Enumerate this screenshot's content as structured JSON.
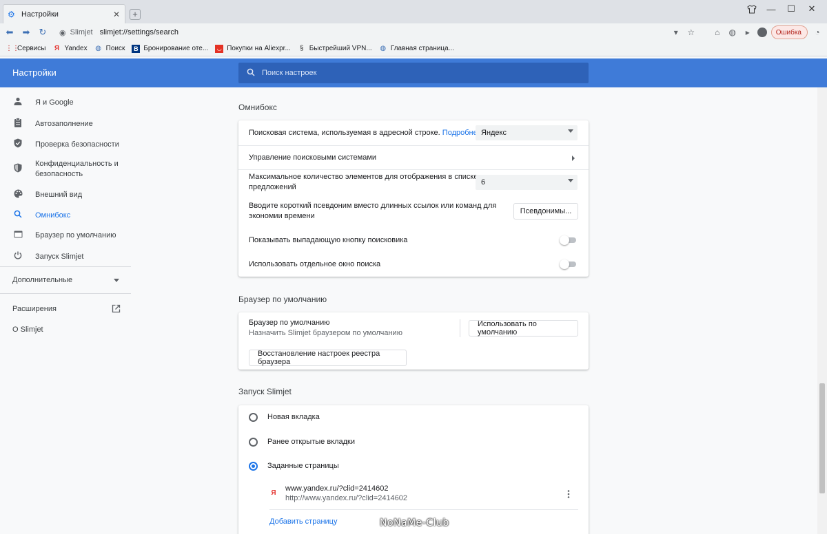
{
  "browser": {
    "tab_title": "Настройки",
    "site_label": "Slimjet",
    "url": "slimjet://settings/search",
    "error_label": "Ошибка"
  },
  "bookmarks": [
    {
      "label": "Сервисы",
      "icon": "apps-grid-icon",
      "color": "#c5221f"
    },
    {
      "label": "Yandex",
      "icon": "yandex-icon",
      "color": "#e53935"
    },
    {
      "label": "Поиск",
      "icon": "globe-icon",
      "color": "#3c6fb4"
    },
    {
      "label": "Бронирование оте...",
      "icon": "booking-icon",
      "color": "#003580"
    },
    {
      "label": "Покупки на Aliexpr...",
      "icon": "aliexpress-icon",
      "color": "#e43225"
    },
    {
      "label": "Быстрейший VPN...",
      "icon": "vpn-icon",
      "color": "#333333"
    },
    {
      "label": "Главная страница...",
      "icon": "globe-icon",
      "color": "#3c6fb4"
    }
  ],
  "header": {
    "title": "Настройки",
    "search_placeholder": "Поиск настроек"
  },
  "sidebar": {
    "items": [
      {
        "label": "Я и Google",
        "icon": "person-icon"
      },
      {
        "label": "Автозаполнение",
        "icon": "clipboard-icon"
      },
      {
        "label": "Проверка безопасности",
        "icon": "shield-check-icon"
      },
      {
        "label": "Конфиденциальность и безопасность",
        "icon": "shield-icon"
      },
      {
        "label": "Внешний вид",
        "icon": "palette-icon"
      },
      {
        "label": "Омнибокс",
        "icon": "search-icon"
      },
      {
        "label": "Браузер по умолчанию",
        "icon": "browser-icon"
      },
      {
        "label": "Запуск Slimjet",
        "icon": "power-icon"
      }
    ],
    "advanced": "Дополнительные",
    "extensions": "Расширения",
    "about": "О Slimjet"
  },
  "omnibox": {
    "title": "Омнибокс",
    "engine_label": "Поисковая система, используемая в адресной строке.",
    "engine_link": "Подробнее",
    "engine_value": "Яндекс",
    "manage_label": "Управление поисковыми системами",
    "max_label_1": "Максимальное количество элементов для отображения в списке",
    "max_label_2": "предложений",
    "max_value": "6",
    "alias_label_1": "Вводите короткий псевдоним вместо длинных ссылок или команд для",
    "alias_label_2": "экономии времени",
    "alias_button": "Псевдонимы...",
    "dropdown_label": "Показывать выпадающую кнопку поисковика",
    "dropdown_on": false,
    "window_label": "Использовать отдельное окно поиска",
    "window_on": false
  },
  "default_browser": {
    "title": "Браузер по умолчанию",
    "label": "Браузер по умолчанию",
    "sublabel": "Назначить Slimjet браузером по умолчанию",
    "make_default_button": "Использовать по умолчанию",
    "restore_button": "Восстановление настроек реестра браузера"
  },
  "startup": {
    "title": "Запуск Slimjet",
    "options": [
      "Новая вкладка",
      "Ранее открытые вкладки",
      "Заданные страницы"
    ],
    "selected": 2,
    "page_title": "www.yandex.ru/?clid=2414602",
    "page_url": "http://www.yandex.ru/?clid=2414602",
    "add_page": "Добавить страницу"
  },
  "watermark": "NoNaMe-Club"
}
